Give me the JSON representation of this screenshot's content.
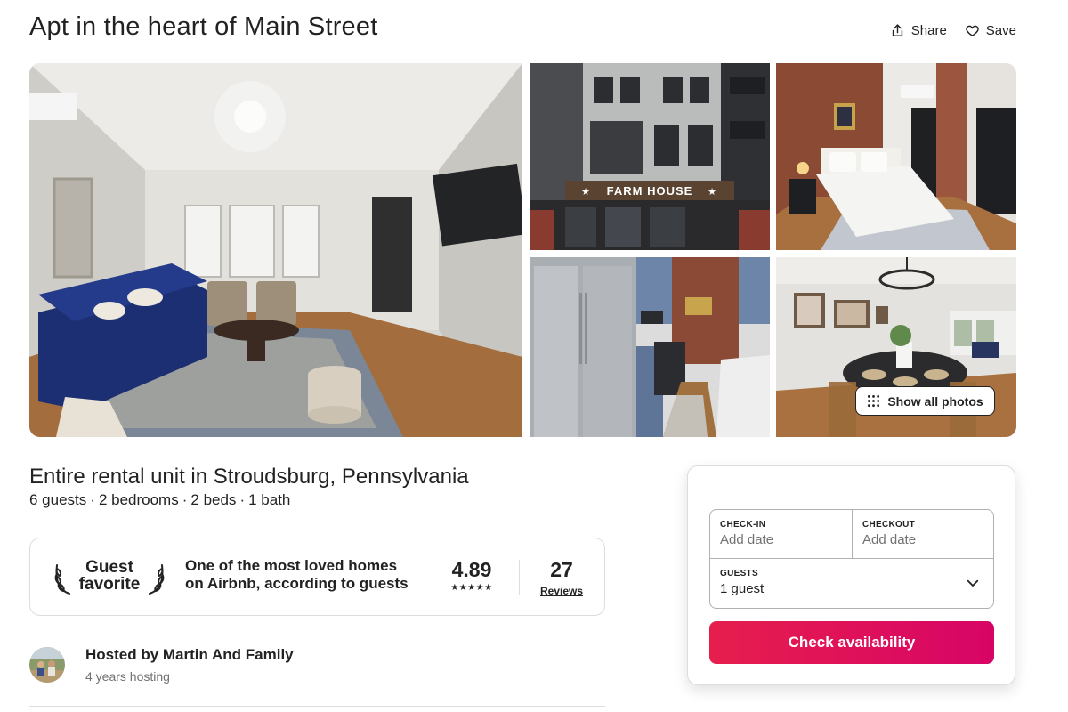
{
  "listing": {
    "title": "Apt in the heart of Main Street",
    "share_label": "Share",
    "save_label": "Save"
  },
  "photos": {
    "show_all_label": "Show all photos",
    "sign_text": "FARM HOUSE"
  },
  "overview": {
    "subtitle": "Entire rental unit in Stroudsburg, Pennsylvania",
    "details": [
      "6 guests",
      "2 bedrooms",
      "2 beds",
      "1 bath"
    ],
    "separator": "·"
  },
  "guest_favorite": {
    "badge_line1": "Guest",
    "badge_line2": "favorite",
    "description": "One of the most loved homes on Airbnb, according to guests",
    "rating": "4.89",
    "stars": "★★★★★",
    "review_count": "27",
    "reviews_label": "Reviews"
  },
  "host": {
    "name": "Hosted by Martin And Family",
    "years": "4 years hosting"
  },
  "booking": {
    "checkin_label": "CHECK-IN",
    "checkin_value": "Add date",
    "checkout_label": "CHECKOUT",
    "checkout_value": "Add date",
    "guests_label": "GUESTS",
    "guests_value": "1 guest",
    "cta_label": "Check availability"
  },
  "colors": {
    "brand": "#e61e4d",
    "brand_end": "#d70466",
    "text": "#222222",
    "muted": "#717171",
    "border": "#dddddd"
  },
  "icons": [
    "share-icon",
    "heart-icon",
    "grid-dots-icon",
    "laurel-left-icon",
    "laurel-right-icon",
    "star-icon",
    "chevron-down-icon"
  ]
}
